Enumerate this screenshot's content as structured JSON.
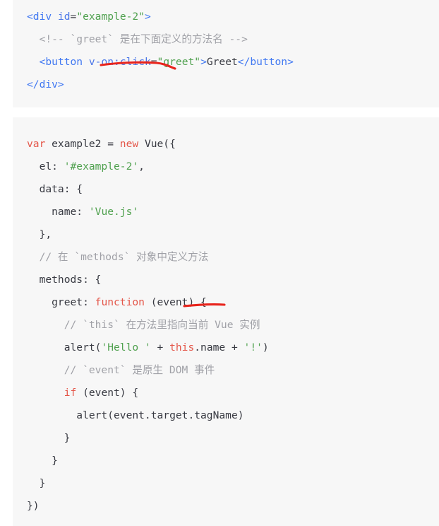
{
  "page": {
    "background_color": "#ffffff",
    "code_block_background": "#f7f7f7"
  },
  "theme": {
    "tag_color": "#4078f2",
    "attribute_color": "#4a76e8",
    "string_color": "#50a14f",
    "keyword_color": "#e45649",
    "comment_color": "#a0a1a7",
    "text_color": "#383a42",
    "annotation_color": "#e8241c"
  },
  "blocks": [
    {
      "id": "block-html",
      "language": "html",
      "lines": [
        {
          "id": "h1",
          "tokens": [
            {
              "t": "<div ",
              "c": "tag"
            },
            {
              "t": "id",
              "c": "attr"
            },
            {
              "t": "=",
              "c": "punct"
            },
            {
              "t": "\"example-2\"",
              "c": "str"
            },
            {
              "t": ">",
              "c": "tag"
            }
          ]
        },
        {
          "id": "h2",
          "tokens": [
            {
              "t": "  <!-- `greet` 是在下面定义的方法名 -->",
              "c": "cmt"
            }
          ]
        },
        {
          "id": "h3",
          "tokens": [
            {
              "t": "  <button ",
              "c": "tag"
            },
            {
              "t": "v-on:click",
              "c": "attr"
            },
            {
              "t": "=",
              "c": "punct"
            },
            {
              "t": "\"greet\"",
              "c": "str"
            },
            {
              "t": ">",
              "c": "tag"
            },
            {
              "t": "Greet",
              "c": "txt"
            },
            {
              "t": "</button>",
              "c": "tag"
            }
          ]
        },
        {
          "id": "h4",
          "tokens": [
            {
              "t": "</div>",
              "c": "tag"
            }
          ]
        }
      ]
    },
    {
      "id": "block-js",
      "language": "javascript",
      "lines": [
        {
          "id": "j1",
          "tokens": [
            {
              "t": "var",
              "c": "kw"
            },
            {
              "t": " example2 = ",
              "c": "txt"
            },
            {
              "t": "new",
              "c": "kw"
            },
            {
              "t": " Vue({",
              "c": "txt"
            }
          ]
        },
        {
          "id": "j2",
          "tokens": [
            {
              "t": "  el: ",
              "c": "txt"
            },
            {
              "t": "'#example-2'",
              "c": "str"
            },
            {
              "t": ",",
              "c": "txt"
            }
          ]
        },
        {
          "id": "j3",
          "tokens": [
            {
              "t": "  data: {",
              "c": "txt"
            }
          ]
        },
        {
          "id": "j4",
          "tokens": [
            {
              "t": "    name: ",
              "c": "txt"
            },
            {
              "t": "'Vue.js'",
              "c": "str"
            }
          ]
        },
        {
          "id": "j5",
          "tokens": [
            {
              "t": "  },",
              "c": "txt"
            }
          ]
        },
        {
          "id": "j6",
          "tokens": [
            {
              "t": "  // 在 `methods` 对象中定义方法",
              "c": "cmt"
            }
          ]
        },
        {
          "id": "j7",
          "tokens": [
            {
              "t": "  methods: {",
              "c": "txt"
            }
          ]
        },
        {
          "id": "j8",
          "tokens": [
            {
              "t": "    greet: ",
              "c": "txt"
            },
            {
              "t": "function",
              "c": "kw"
            },
            {
              "t": " (event) {",
              "c": "txt"
            }
          ]
        },
        {
          "id": "j9",
          "tokens": [
            {
              "t": "      // `this` 在方法里指向当前 Vue 实例",
              "c": "cmt"
            }
          ]
        },
        {
          "id": "j10",
          "tokens": [
            {
              "t": "      alert(",
              "c": "txt"
            },
            {
              "t": "'Hello '",
              "c": "str"
            },
            {
              "t": " + ",
              "c": "txt"
            },
            {
              "t": "this",
              "c": "kw"
            },
            {
              "t": ".name + ",
              "c": "txt"
            },
            {
              "t": "'!'",
              "c": "str"
            },
            {
              "t": ")",
              "c": "txt"
            }
          ]
        },
        {
          "id": "j11",
          "tokens": [
            {
              "t": "      // `event` 是原生 DOM 事件",
              "c": "cmt"
            }
          ]
        },
        {
          "id": "j12",
          "tokens": [
            {
              "t": "      ",
              "c": "txt"
            },
            {
              "t": "if",
              "c": "kw"
            },
            {
              "t": " (event) {",
              "c": "txt"
            }
          ]
        },
        {
          "id": "j13",
          "tokens": [
            {
              "t": "        alert(event.target.tagName)",
              "c": "txt"
            }
          ]
        },
        {
          "id": "j14",
          "tokens": [
            {
              "t": "      }",
              "c": "txt"
            }
          ]
        },
        {
          "id": "j15",
          "tokens": [
            {
              "t": "    }",
              "c": "txt"
            }
          ]
        },
        {
          "id": "j16",
          "tokens": [
            {
              "t": "  }",
              "c": "txt"
            }
          ]
        },
        {
          "id": "j17",
          "tokens": [
            {
              "t": "})",
              "c": "txt"
            }
          ]
        }
      ]
    }
  ],
  "annotations": [
    {
      "id": "underline-v-on-click",
      "target_text": "v-on:click",
      "color": "#e8241c",
      "shape": "hand-drawn-underline"
    },
    {
      "id": "underline-event-param",
      "target_text": "(event)",
      "color": "#e8241c",
      "shape": "hand-drawn-underline"
    }
  ]
}
